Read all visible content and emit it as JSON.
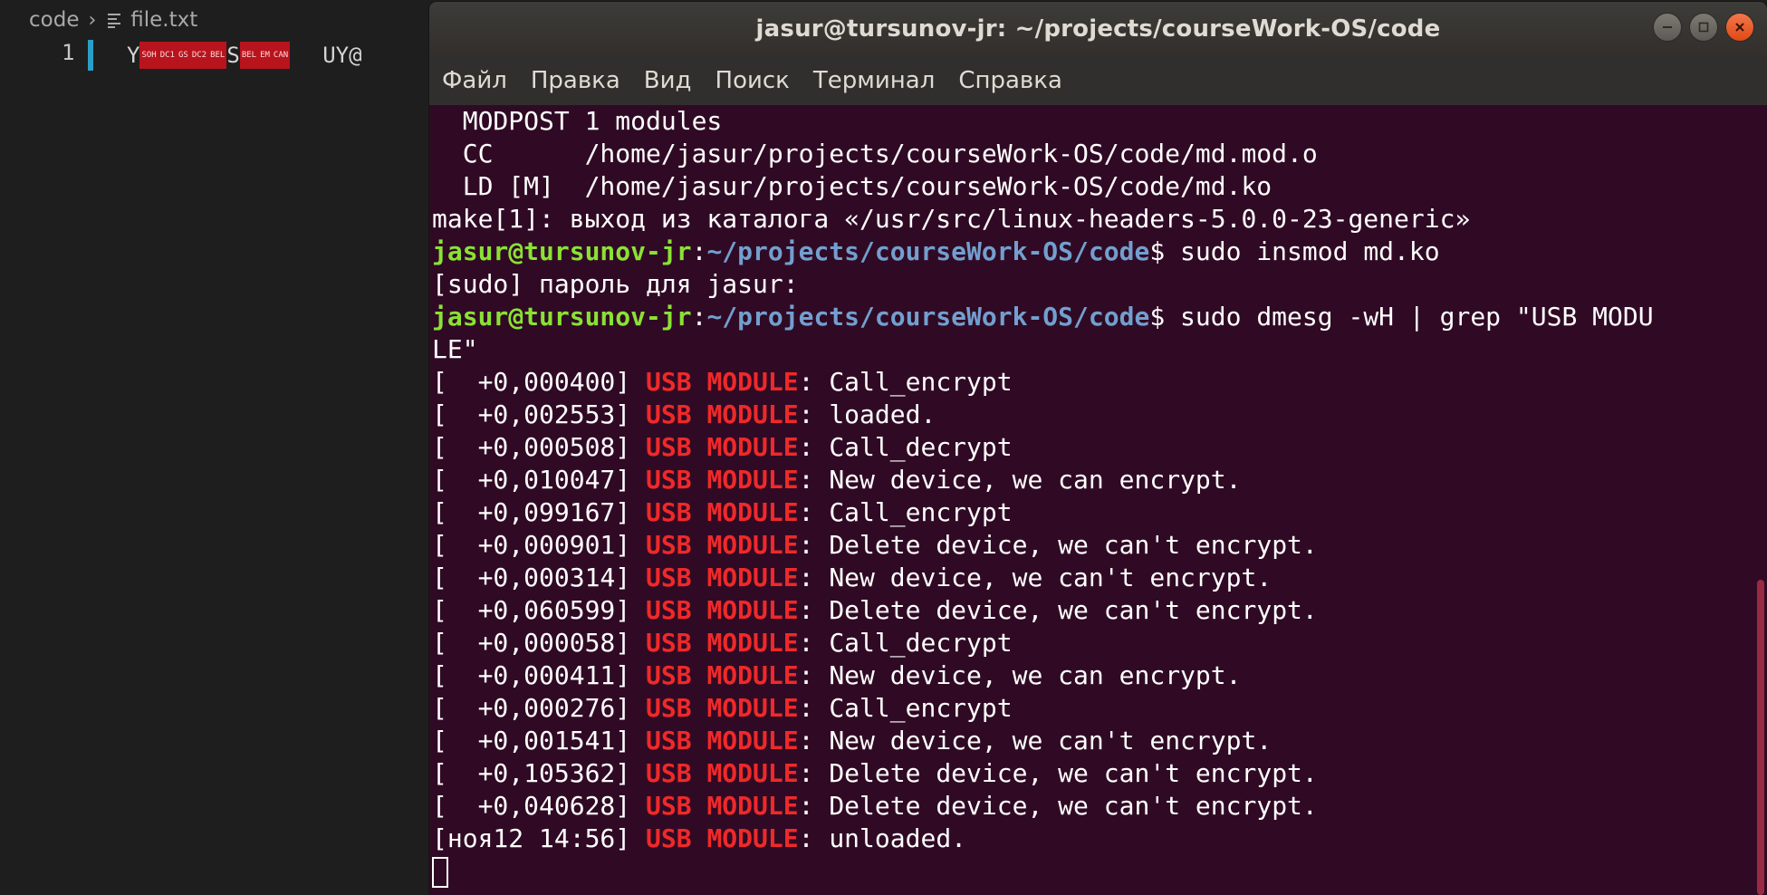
{
  "editor": {
    "breadcrumb": {
      "folder": "code",
      "file": "file.txt"
    },
    "line_number": "1",
    "line_text_start": "Y",
    "control_chars_1": [
      "SOH",
      "DC1",
      "GS",
      "DC2",
      "BEL"
    ],
    "line_text_mid": "S",
    "control_chars_2": [
      "BEL",
      "EM",
      "CAN"
    ],
    "line_text_end": "UY@"
  },
  "terminal": {
    "title": "jasur@tursunov-jr: ~/projects/courseWork-OS/code",
    "menu": [
      "Файл",
      "Правка",
      "Вид",
      "Поиск",
      "Терминал",
      "Справка"
    ],
    "build_lines": [
      "  MODPOST 1 modules",
      "  CC      /home/jasur/projects/courseWork-OS/code/md.mod.o",
      "  LD [M]  /home/jasur/projects/courseWork-OS/code/md.ko",
      "make[1]: выход из каталога «/usr/src/linux-headers-5.0.0-23-generic»"
    ],
    "prompt_user": "jasur@tursunov-jr",
    "prompt_path": "~/projects/courseWork-OS/code",
    "cmd1": " sudo insmod md.ko",
    "sudo_prompt": "[sudo] пароль для jasur:",
    "cmd2": " sudo dmesg -wH | grep \"USB MODU",
    "cmd2_wrap": "LE\"",
    "module_tag_1": "USB",
    "module_tag_2": "MODULE",
    "log": [
      {
        "ts": "[  +0,000400]",
        "msg": ": Call_encrypt"
      },
      {
        "ts": "[  +0,002553]",
        "msg": ": loaded."
      },
      {
        "ts": "[  +0,000508]",
        "msg": ": Call_decrypt"
      },
      {
        "ts": "[  +0,010047]",
        "msg": ": New device, we can encrypt."
      },
      {
        "ts": "[  +0,099167]",
        "msg": ": Call_encrypt"
      },
      {
        "ts": "[  +0,000901]",
        "msg": ": Delete device, we can't encrypt."
      },
      {
        "ts": "[  +0,000314]",
        "msg": ": New device, we can't encrypt."
      },
      {
        "ts": "[  +0,060599]",
        "msg": ": Delete device, we can't encrypt."
      },
      {
        "ts": "[  +0,000058]",
        "msg": ": Call_decrypt"
      },
      {
        "ts": "[  +0,000411]",
        "msg": ": New device, we can encrypt."
      },
      {
        "ts": "[  +0,000276]",
        "msg": ": Call_encrypt"
      },
      {
        "ts": "[  +0,001541]",
        "msg": ": New device, we can't encrypt."
      },
      {
        "ts": "[  +0,105362]",
        "msg": ": Delete device, we can't encrypt."
      },
      {
        "ts": "[  +0,040628]",
        "msg": ": Delete device, we can't encrypt."
      },
      {
        "ts": "[ноя12 14:56]",
        "msg": ": unloaded."
      }
    ]
  },
  "colors": {
    "terminal_bg": "#300a24",
    "prompt_user": "#8ae234",
    "prompt_path": "#729fcf",
    "highlight": "#ef2929",
    "close_button": "#df4a16"
  },
  "icons": [
    "chevron-right-icon",
    "text-file-icon",
    "minimize-icon",
    "maximize-icon",
    "close-icon",
    "cursor-block"
  ]
}
